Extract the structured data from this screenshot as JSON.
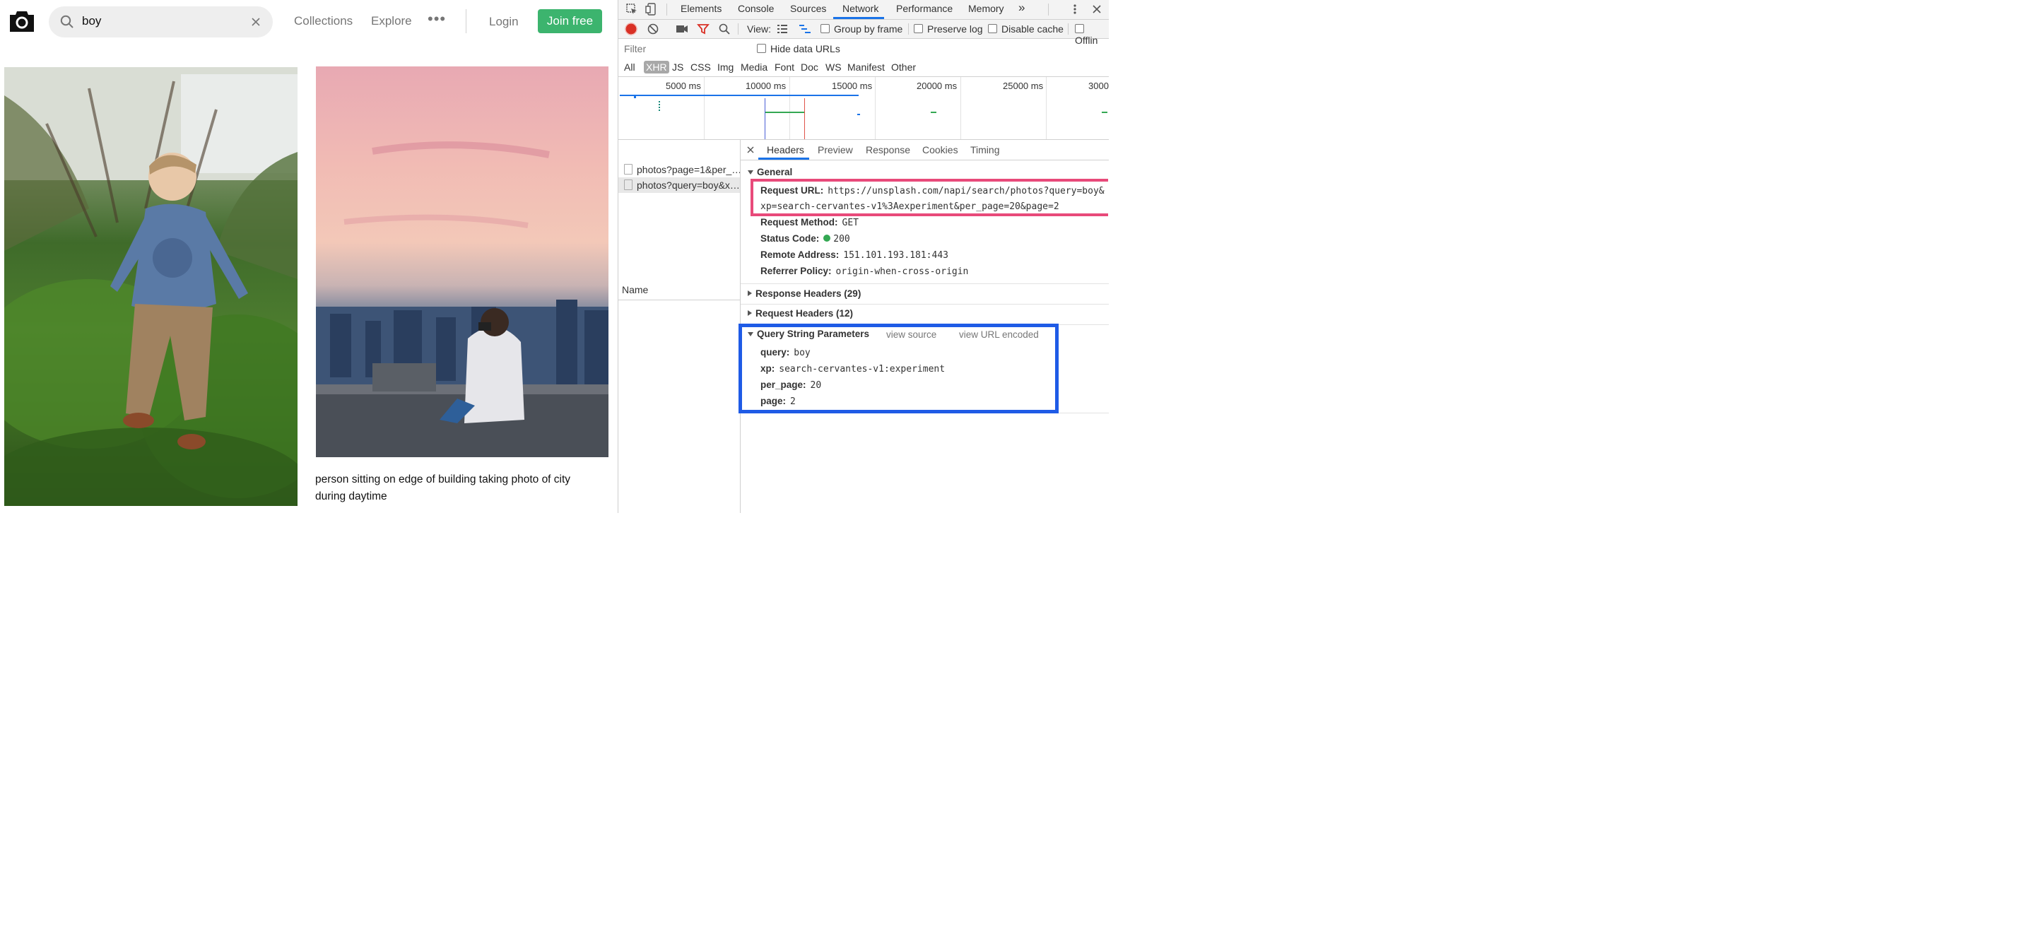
{
  "site": {
    "search": {
      "value": "boy"
    },
    "nav": {
      "collections": "Collections",
      "explore": "Explore",
      "more": "•••"
    },
    "login": "Login",
    "join": "Join free",
    "photo2_caption": "person sitting on edge of building taking photo of city during daytime"
  },
  "devtools": {
    "tabs": [
      "Elements",
      "Console",
      "Sources",
      "Network",
      "Performance",
      "Memory"
    ],
    "overflow": "»",
    "toolbar": {
      "view_label": "View:",
      "group_by_frame": "Group by frame",
      "preserve_log": "Preserve log",
      "disable_cache": "Disable cache",
      "offline": "Offlin"
    },
    "filter": {
      "placeholder": "Filter",
      "hide_data_urls": "Hide data URLs"
    },
    "types": [
      "All",
      "XHR",
      "JS",
      "CSS",
      "Img",
      "Media",
      "Font",
      "Doc",
      "WS",
      "Manifest",
      "Other"
    ],
    "timeline": {
      "ticks": [
        "5000 ms",
        "10000 ms",
        "15000 ms",
        "20000 ms",
        "25000 ms",
        "3000"
      ]
    },
    "names": {
      "header": "Name",
      "rows": [
        "photos?page=1&per_…",
        "photos?query=boy&x…"
      ]
    },
    "detail_tabs": [
      "Headers",
      "Preview",
      "Response",
      "Cookies",
      "Timing"
    ],
    "general": {
      "title": "General",
      "request_url_label": "Request URL:",
      "request_url_line1": "https://unsplash.com/napi/search/photos?query=boy&",
      "request_url_line2": "xp=search-cervantes-v1%3Aexperiment&per_page=20&page=2",
      "method_label": "Request Method:",
      "method": "GET",
      "status_label": "Status Code:",
      "status": "200",
      "remote_label": "Remote Address:",
      "remote": "151.101.193.181:443",
      "referrer_label": "Referrer Policy:",
      "referrer": "origin-when-cross-origin"
    },
    "response_headers": "Response Headers (29)",
    "request_headers": "Request Headers (12)",
    "query": {
      "title": "Query String Parameters",
      "view_source": "view source",
      "view_url_encoded": "view URL encoded",
      "params": [
        {
          "k": "query:",
          "v": "boy"
        },
        {
          "k": "xp:",
          "v": "search-cervantes-v1:experiment"
        },
        {
          "k": "per_page:",
          "v": "20"
        },
        {
          "k": "page:",
          "v": "2"
        }
      ]
    },
    "colors": {
      "accent": "#1a73e8",
      "record": "#d93025",
      "status_ok": "#34a853",
      "highlight_red": "#e84a7a",
      "highlight_blue": "#1f5be6"
    }
  }
}
